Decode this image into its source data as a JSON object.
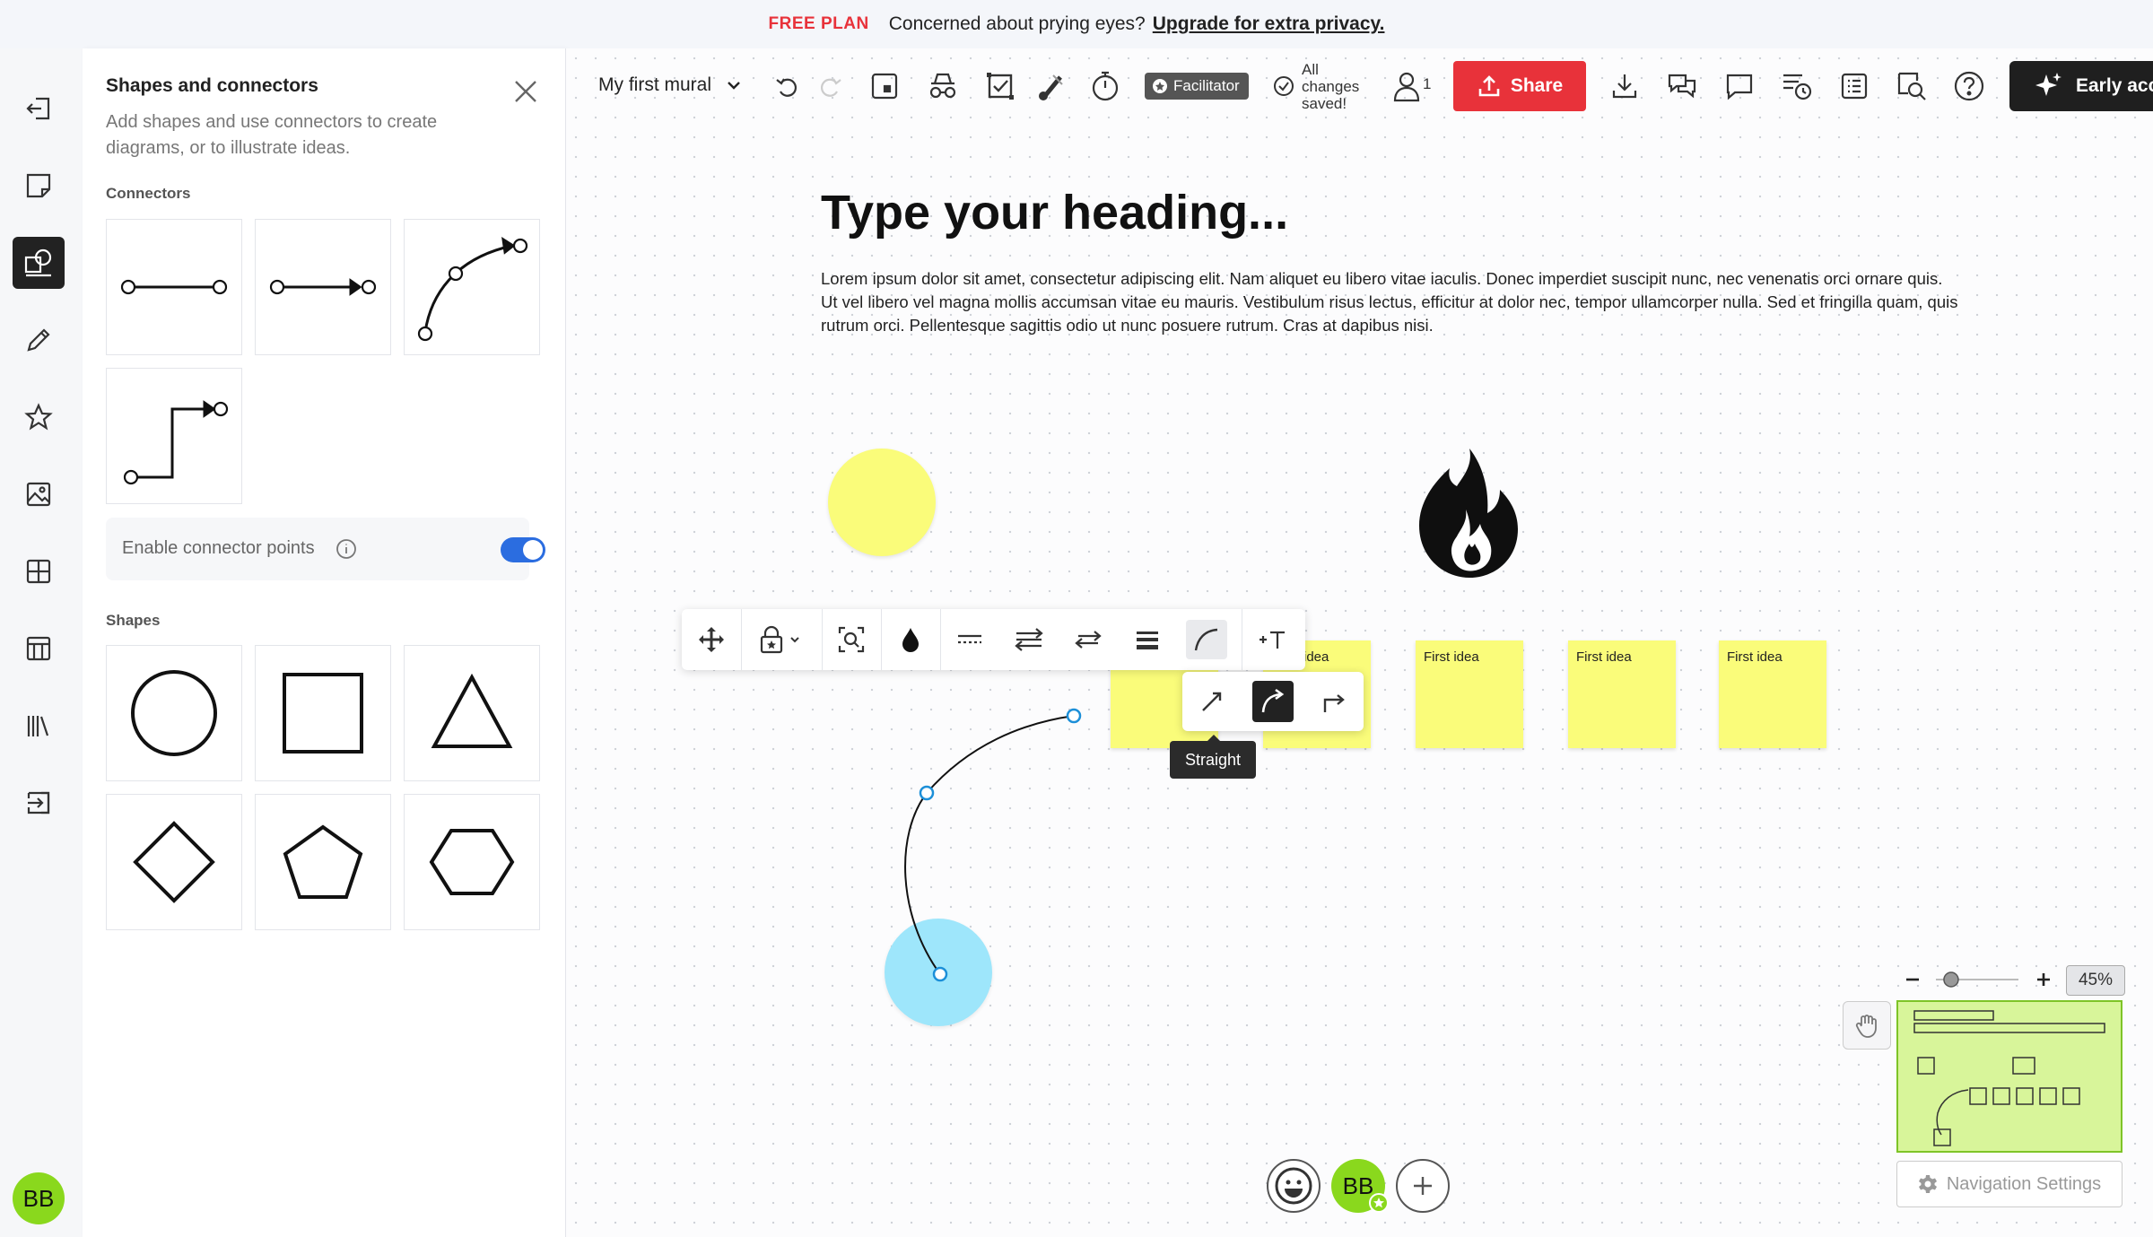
{
  "banner": {
    "plan": "FREE PLAN",
    "message": "Concerned about prying eyes?",
    "link": "Upgrade for extra privacy."
  },
  "rail": {
    "avatar_initials": "BB",
    "icons": [
      "exit-icon",
      "sticky-note-icon",
      "shapes-icon",
      "pen-icon",
      "star-icon",
      "image-icon",
      "grid-icon",
      "table-icon",
      "library-icon",
      "import-icon"
    ]
  },
  "panel": {
    "title": "Shapes and connectors",
    "description": "Add shapes and use connectors to create diagrams, or to illustrate ideas.",
    "connectors_label": "Connectors",
    "enable_connector_points": "Enable connector points",
    "toggle_on": true,
    "shapes_label": "Shapes"
  },
  "toolbar": {
    "mural_name": "My first mural",
    "facilitator": "Facilitator",
    "saved_line1": "All",
    "saved_line2": "changes",
    "saved_line3": "saved!",
    "users_count": "1",
    "share": "Share",
    "early_access": "Early acc"
  },
  "mural": {
    "heading": "Type your heading...",
    "paragraph": "Lorem ipsum dolor sit amet, consectetur adipiscing elit. Nam aliquet eu libero vitae iaculis. Donec imperdiet suscipit nunc, nec venenatis orci ornare quis. Ut vel libero vel magna mollis accumsan vitae eu mauris. Vestibulum risus lectus, efficitur at dolor nec, tempor ullamcorper nulla. Sed et fringilla quam, quis rutrum orci. Pellentesque sagittis odio ut nunc posuere rutrum. Cras at dapibus nisi.",
    "stickies": [
      "idea",
      "First idea",
      "First idea",
      "First idea"
    ]
  },
  "connector_menu": {
    "tooltip": "Straight"
  },
  "bottom": {
    "avatar_initials": "BB"
  },
  "zoom": {
    "percent": "45%",
    "level": 0.45
  },
  "navigation_settings": "Navigation Settings",
  "colors": {
    "accent_red": "#e8323a",
    "toggle_blue": "#2b6de0",
    "sticky_yellow": "#fafc7a",
    "circle_blue": "#9ee6fb",
    "avatar_green": "#8ad81d"
  }
}
